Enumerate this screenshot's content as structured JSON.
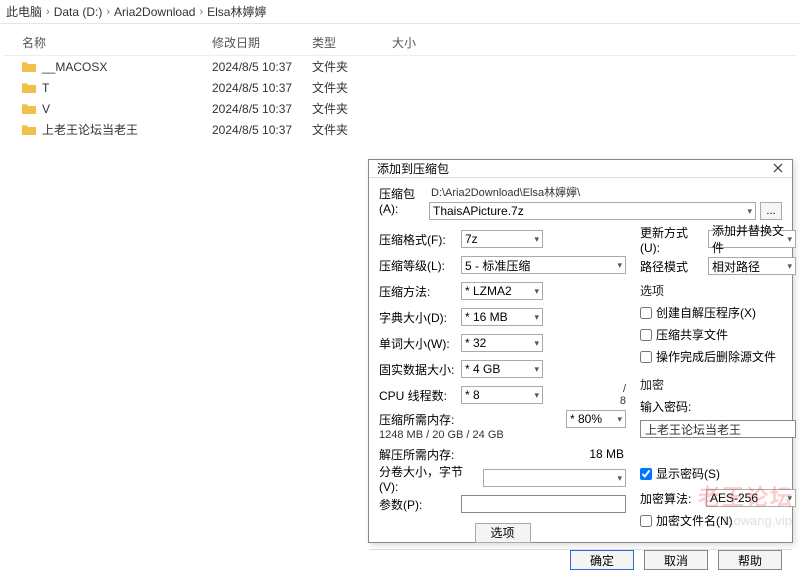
{
  "breadcrumb": {
    "items": [
      "此电脑",
      "Data (D:)",
      "Aria2Download",
      "Elsa林嬣嬣"
    ]
  },
  "columns": {
    "name": "名称",
    "date": "修改日期",
    "type": "类型",
    "size": "大小"
  },
  "files": [
    {
      "name": "__MACOSX",
      "date": "2024/8/5 10:37",
      "type": "文件夹",
      "size": ""
    },
    {
      "name": "T",
      "date": "2024/8/5 10:37",
      "type": "文件夹",
      "size": ""
    },
    {
      "name": "V",
      "date": "2024/8/5 10:37",
      "type": "文件夹",
      "size": ""
    },
    {
      "name": "上老王论坛当老王",
      "date": "2024/8/5 10:37",
      "type": "文件夹",
      "size": ""
    }
  ],
  "dialog": {
    "title": "添加到压缩包",
    "archive_label": "压缩包(A):",
    "archive_dir": "D:\\Aria2Download\\Elsa林嬣嬣\\",
    "archive_name": "ThaisAPicture.7z",
    "browse": "...",
    "left": {
      "format_label": "压缩格式(F):",
      "format": "7z",
      "level_label": "压缩等级(L):",
      "level": "5 - 标准压缩",
      "method_label": "压缩方法:",
      "method": "* LZMA2",
      "dict_label": "字典大小(D):",
      "dict": "* 16 MB",
      "word_label": "单词大小(W):",
      "word": "* 32",
      "solid_label": "固实数据大小:",
      "solid": "* 4 GB",
      "threads_label": "CPU 线程数:",
      "threads": "* 8",
      "threads_total": "/ 8",
      "mem_comp_label": "压缩所需内存:",
      "mem_vals": "1248 MB / 20 GB / 24 GB",
      "mem_pct": "* 80%",
      "mem_decomp_label": "解压所需内存:",
      "mem_decomp": "18 MB",
      "split_label": "分卷大小，字节(V):",
      "split": "",
      "params_label": "参数(P):",
      "params": ""
    },
    "right": {
      "update_label": "更新方式(U):",
      "update": "添加并替换文件",
      "pathmode_label": "路径模式",
      "pathmode": "相对路径",
      "options_head": "选项",
      "opt_sfx": "创建自解压程序(X)",
      "opt_shared": "压缩共享文件",
      "opt_delete": "操作完成后删除源文件",
      "enc_head": "加密",
      "pwd_label": "输入密码:",
      "pwd": "上老王论坛当老王",
      "show_pwd": "显示密码(S)",
      "enc_method_label": "加密算法:",
      "enc_method": "AES-256",
      "enc_names": "加密文件名(N)"
    },
    "options_btn": "选项",
    "ok": "确定",
    "cancel": "取消",
    "help": "帮助"
  },
  "watermark": {
    "main": "老王论坛",
    "sub": "laowang.vip"
  }
}
